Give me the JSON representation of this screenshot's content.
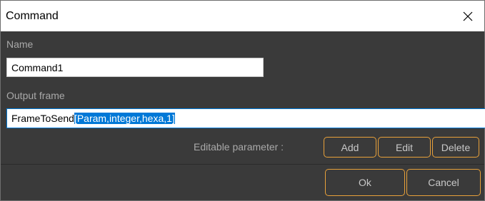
{
  "window": {
    "title": "Command"
  },
  "icons": {
    "close": "close-icon"
  },
  "name_section": {
    "label": "Name",
    "value": "Command1"
  },
  "output_section": {
    "label": "Output frame",
    "value_plain": "FrameToSend",
    "value_selected": "[Param,integer,hexa,1]"
  },
  "parameter_section": {
    "label": "Editable parameter :",
    "add_label": "Add",
    "edit_label": "Edit",
    "delete_label": "Delete"
  },
  "footer": {
    "ok_label": "Ok",
    "cancel_label": "Cancel"
  },
  "colors": {
    "body_background": "#3a3a3a",
    "button_border": "#e8a13a",
    "selection": "#0078d7",
    "label_text": "#a9a9a9"
  }
}
